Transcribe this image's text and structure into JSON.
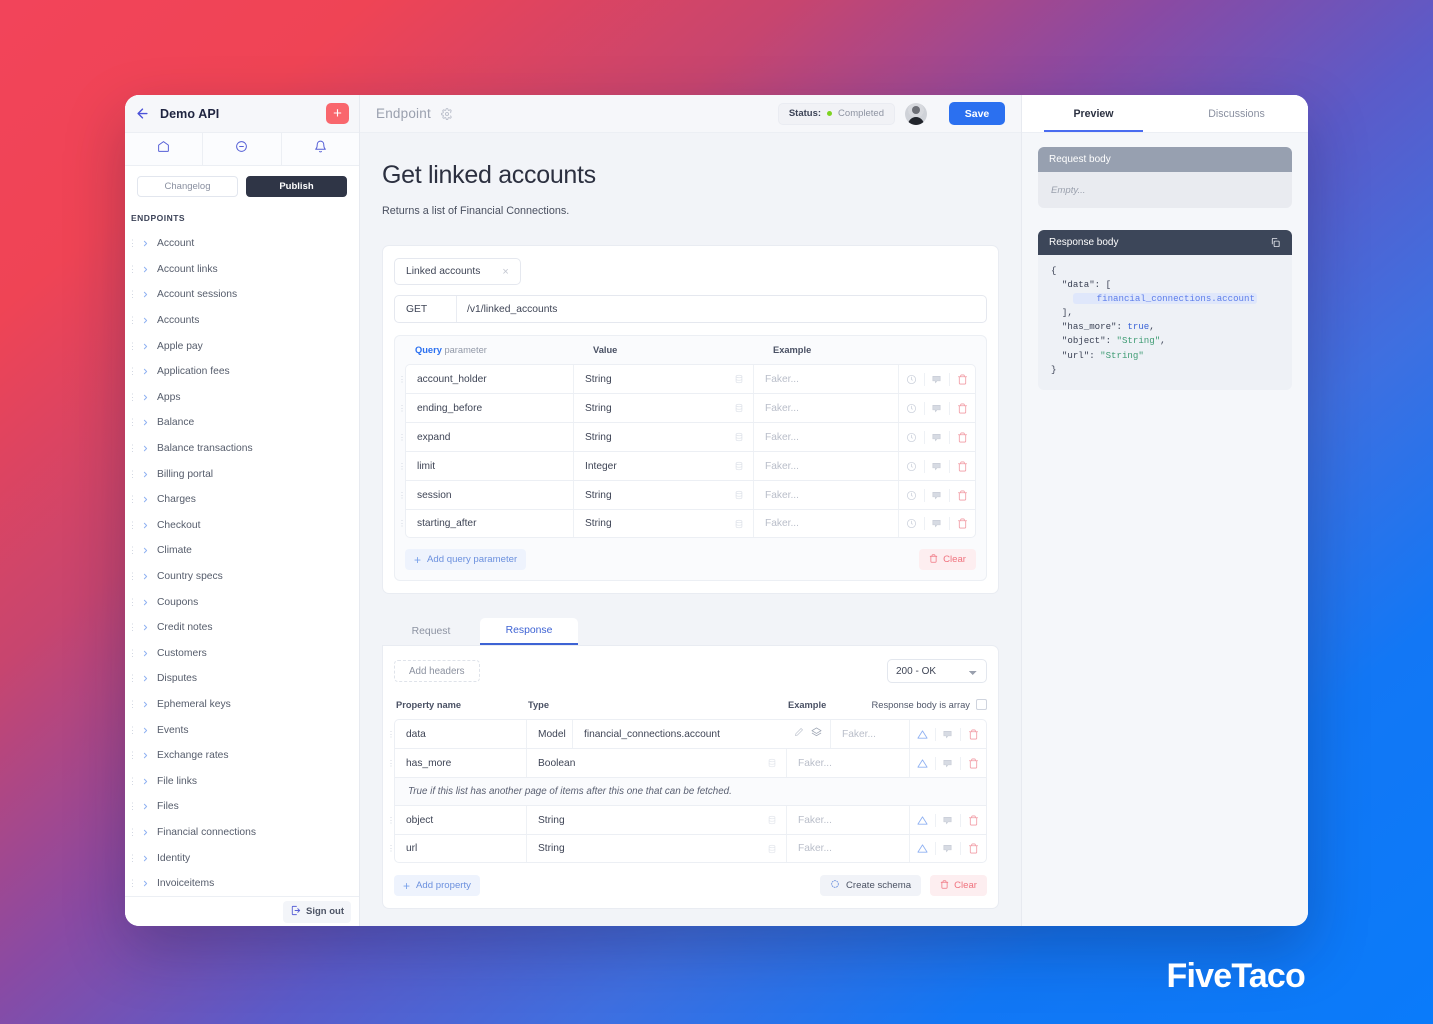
{
  "sidebar": {
    "title": "Demo API",
    "back_icon": "arrow-left-icon",
    "add_label": "+",
    "nav": [
      {
        "icon": "home-icon",
        "name": "home"
      },
      {
        "icon": "message-icon",
        "name": "messages"
      },
      {
        "icon": "bell-icon",
        "name": "notifications"
      }
    ],
    "changelog_label": "Changelog",
    "publish_label": "Publish",
    "section_title": "ENDPOINTS",
    "items": [
      {
        "label": "Account"
      },
      {
        "label": "Account links"
      },
      {
        "label": "Account sessions"
      },
      {
        "label": "Accounts"
      },
      {
        "label": "Apple pay"
      },
      {
        "label": "Application fees"
      },
      {
        "label": "Apps"
      },
      {
        "label": "Balance"
      },
      {
        "label": "Balance transactions"
      },
      {
        "label": "Billing portal"
      },
      {
        "label": "Charges"
      },
      {
        "label": "Checkout"
      },
      {
        "label": "Climate"
      },
      {
        "label": "Country specs"
      },
      {
        "label": "Coupons"
      },
      {
        "label": "Credit notes"
      },
      {
        "label": "Customers"
      },
      {
        "label": "Disputes"
      },
      {
        "label": "Ephemeral keys"
      },
      {
        "label": "Events"
      },
      {
        "label": "Exchange rates"
      },
      {
        "label": "File links"
      },
      {
        "label": "Files"
      },
      {
        "label": "Financial connections"
      },
      {
        "label": "Identity"
      },
      {
        "label": "Invoiceitems"
      }
    ],
    "signout_label": "Sign out"
  },
  "topbar": {
    "endpoint_label": "Endpoint",
    "gear_icon": "gear-icon",
    "status_label": "Status:",
    "status_value": "Completed",
    "status_color": "#7ed321",
    "save_label": "Save",
    "save_color": "#2b70f0"
  },
  "page": {
    "title": "Get linked accounts",
    "description": "Returns a list of Financial Connections."
  },
  "request_card": {
    "chip_label": "Linked accounts",
    "chip_close": "×",
    "method": "GET",
    "path": "/v1/linked_accounts",
    "table": {
      "header_query": "Query",
      "header_param": " parameter",
      "header_value": "Value",
      "header_example": "Example",
      "rows": [
        {
          "name": "account_holder",
          "type": "String",
          "example": "Faker..."
        },
        {
          "name": "ending_before",
          "type": "String",
          "example": "Faker..."
        },
        {
          "name": "expand",
          "type": "String",
          "example": "Faker..."
        },
        {
          "name": "limit",
          "type": "Integer",
          "example": "Faker..."
        },
        {
          "name": "session",
          "type": "String",
          "example": "Faker..."
        },
        {
          "name": "starting_after",
          "type": "String",
          "example": "Faker..."
        }
      ],
      "add_label": "Add query parameter",
      "clear_label": "Clear"
    }
  },
  "response_section": {
    "tabs": [
      {
        "label": "Request",
        "active": false
      },
      {
        "label": "Response",
        "active": true
      }
    ],
    "add_headers_label": "Add headers",
    "status_select": "200 - OK",
    "status_options": [
      "200 - OK"
    ],
    "col_property": "Property name",
    "col_type": "Type",
    "col_example": "Example",
    "is_array_label": "Response body is array",
    "rows": [
      {
        "name": "data",
        "type": "Model",
        "model": "financial_connections.account",
        "example": "Faker...",
        "note": null
      },
      {
        "name": "has_more",
        "type": "Boolean",
        "model": "",
        "example": "Faker...",
        "note": "True if this list has another page of items after this one that can be fetched."
      },
      {
        "name": "object",
        "type": "String",
        "model": "",
        "example": "Faker...",
        "note": null
      },
      {
        "name": "url",
        "type": "String",
        "model": "",
        "example": "Faker...",
        "note": null
      }
    ],
    "add_property_label": "Add property",
    "create_schema_label": "Create schema",
    "clear_label": "Clear"
  },
  "right_panel": {
    "tabs": [
      {
        "label": "Preview",
        "active": true
      },
      {
        "label": "Discussions",
        "active": false
      }
    ],
    "request_body_title": "Request body",
    "request_body_empty": "Empty...",
    "response_body_title": "Response body",
    "copy_icon": "copy-icon",
    "response_code": {
      "l1": "{",
      "l2": "  \"data\": [",
      "l3": "    financial_connections.account",
      "l4": "  ],",
      "l5_key": "  \"has_more\": ",
      "l5_val": "true",
      "l5_end": ",",
      "l6_key": "  \"object\": ",
      "l6_val": "\"String\"",
      "l6_end": ",",
      "l7_key": "  \"url\": ",
      "l7_val": "\"String\"",
      "l8": "}"
    }
  },
  "watermark": {
    "text": "FiveTaco"
  }
}
